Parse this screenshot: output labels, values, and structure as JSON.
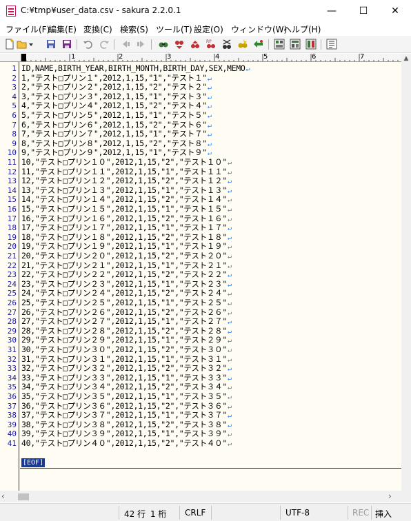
{
  "window": {
    "title": "C:¥tmp¥user_data.csv - sakura 2.2.0.1",
    "minimize": "—",
    "maximize": "☐",
    "close": "✕"
  },
  "menu": [
    "ファイル(F)",
    "編集(E)",
    "変換(C)",
    "検索(S)",
    "ツール(T)",
    "設定(O)",
    "ウィンドウ(W)",
    "ヘルプ(H)"
  ],
  "toolbar_icons": [
    "new-file-icon",
    "open-dropdown-icon",
    "save-icon",
    "save-as-icon",
    "undo-icon",
    "redo-icon",
    "jump-back-icon",
    "jump-forward-icon",
    "find-icon",
    "find-prev-icon",
    "find-next-icon",
    "replace-icon",
    "grep-icon",
    "bookmark-icon",
    "settings-icon",
    "type-settings-icon",
    "font-icon",
    "outline-icon"
  ],
  "ruler": {
    "numbers": [
      "1",
      "2",
      "3",
      "4",
      "5",
      "6",
      "7"
    ]
  },
  "lines": [
    "ID,NAME,BIRTH_YEAR,BIRTH_MONTH,BIRTH_DAY,SEX,MEMO",
    "1,\"テスト□プリン１\",2012,1,15,\"1\",\"テスト１\"",
    "2,\"テスト□プリン２\",2012,1,15,\"2\",\"テスト２\"",
    "3,\"テスト□プリン３\",2012,1,15,\"1\",\"テスト３\"",
    "4,\"テスト□プリン４\",2012,1,15,\"2\",\"テスト４\"",
    "5,\"テスト□プリン５\",2012,1,15,\"1\",\"テスト５\"",
    "6,\"テスト□プリン６\",2012,1,15,\"2\",\"テスト６\"",
    "7,\"テスト□プリン７\",2012,1,15,\"1\",\"テスト７\"",
    "8,\"テスト□プリン８\",2012,1,15,\"2\",\"テスト８\"",
    "9,\"テスト□プリン９\",2012,1,15,\"1\",\"テスト９\"",
    "10,\"テスト□プリン１０\",2012,1,15,\"2\",\"テスト１０\"",
    "11,\"テスト□プリン１１\",2012,1,15,\"1\",\"テスト１１\"",
    "12,\"テスト□プリン１２\",2012,1,15,\"2\",\"テスト１２\"",
    "13,\"テスト□プリン１３\",2012,1,15,\"1\",\"テスト１３\"",
    "14,\"テスト□プリン１４\",2012,1,15,\"2\",\"テスト１４\"",
    "15,\"テスト□プリン１５\",2012,1,15,\"1\",\"テスト１５\"",
    "16,\"テスト□プリン１６\",2012,1,15,\"2\",\"テスト１６\"",
    "17,\"テスト□プリン１７\",2012,1,15,\"1\",\"テスト１７\"",
    "18,\"テスト□プリン１８\",2012,1,15,\"2\",\"テスト１８\"",
    "19,\"テスト□プリン１９\",2012,1,15,\"1\",\"テスト１９\"",
    "20,\"テスト□プリン２０\",2012,1,15,\"2\",\"テスト２０\"",
    "21,\"テスト□プリン２１\",2012,1,15,\"1\",\"テスト２１\"",
    "22,\"テスト□プリン２２\",2012,1,15,\"2\",\"テスト２２\"",
    "23,\"テスト□プリン２３\",2012,1,15,\"1\",\"テスト２３\"",
    "24,\"テスト□プリン２４\",2012,1,15,\"2\",\"テスト２４\"",
    "25,\"テスト□プリン２５\",2012,1,15,\"1\",\"テスト２５\"",
    "26,\"テスト□プリン２６\",2012,1,15,\"2\",\"テスト２６\"",
    "27,\"テスト□プリン２７\",2012,1,15,\"1\",\"テスト２７\"",
    "28,\"テスト□プリン２８\",2012,1,15,\"2\",\"テスト２８\"",
    "29,\"テスト□プリン２９\",2012,1,15,\"1\",\"テスト２９\"",
    "30,\"テスト□プリン３０\",2012,1,15,\"2\",\"テスト３０\"",
    "31,\"テスト□プリン３１\",2012,1,15,\"1\",\"テスト３１\"",
    "32,\"テスト□プリン３２\",2012,1,15,\"2\",\"テスト３２\"",
    "33,\"テスト□プリン３３\",2012,1,15,\"1\",\"テスト３３\"",
    "34,\"テスト□プリン３４\",2012,1,15,\"2\",\"テスト３４\"",
    "35,\"テスト□プリン３５\",2012,1,15,\"1\",\"テスト３５\"",
    "36,\"テスト□プリン３６\",2012,1,15,\"2\",\"テスト３６\"",
    "37,\"テスト□プリン３７\",2012,1,15,\"1\",\"テスト３７\"",
    "38,\"テスト□プリン３８\",2012,1,15,\"2\",\"テスト３８\"",
    "39,\"テスト□プリン３９\",2012,1,15,\"1\",\"テスト３９\"",
    "40,\"テスト□プリン４０\",2012,1,15,\"2\",\"テスト４０\""
  ],
  "eol_mark": "↵",
  "eof_label": "[EOF]",
  "status": {
    "row": "42 行",
    "col": "1 桁",
    "eol": "CRLF",
    "encoding": "UTF-8",
    "rec": "REC",
    "mode": "挿入"
  },
  "colors": {
    "editor_bg": "#fffdf3",
    "line_number": "#1a1aa0",
    "eol_mark": "#2080ff",
    "eof_bg": "#1a3a9a"
  }
}
